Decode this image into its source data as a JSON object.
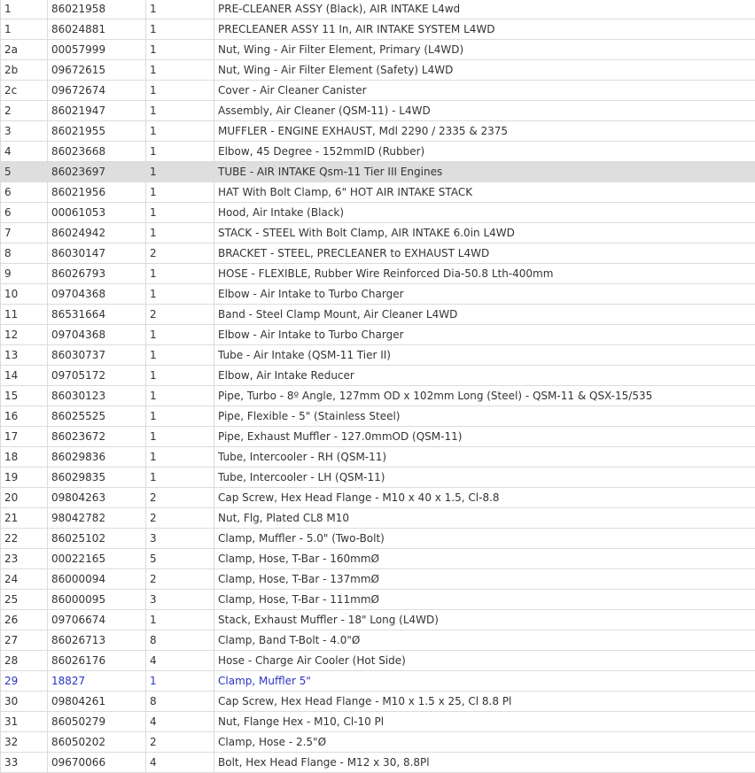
{
  "colors": {
    "text": "#333333",
    "highlight_row_bg": "#dedede",
    "link_text": "#2a35c5",
    "border": "#dcdcdc"
  },
  "parts_table": {
    "rows": [
      {
        "ref": "1",
        "part_no": "86021958",
        "qty": "1",
        "description": "PRE-CLEANER ASSY (Black), AIR INTAKE L4wd",
        "state": "normal"
      },
      {
        "ref": "1",
        "part_no": "86024881",
        "qty": "1",
        "description": "PRECLEANER ASSY 11 In, AIR INTAKE SYSTEM L4WD",
        "state": "normal"
      },
      {
        "ref": "2a",
        "part_no": "00057999",
        "qty": "1",
        "description": "Nut, Wing - Air Filter Element, Primary (L4WD)",
        "state": "normal"
      },
      {
        "ref": "2b",
        "part_no": "09672615",
        "qty": "1",
        "description": "Nut, Wing - Air Filter Element (Safety) L4WD",
        "state": "normal"
      },
      {
        "ref": "2c",
        "part_no": "09672674",
        "qty": "1",
        "description": "Cover - Air Cleaner Canister",
        "state": "normal"
      },
      {
        "ref": "2",
        "part_no": "86021947",
        "qty": "1",
        "description": "Assembly, Air Cleaner (QSM-11) - L4WD",
        "state": "normal"
      },
      {
        "ref": "3",
        "part_no": "86021955",
        "qty": "1",
        "description": "MUFFLER - ENGINE EXHAUST, Mdl 2290 / 2335 & 2375",
        "state": "normal"
      },
      {
        "ref": "4",
        "part_no": "86023668",
        "qty": "1",
        "description": "Elbow, 45 Degree - 152mmID (Rubber)",
        "state": "normal"
      },
      {
        "ref": "5",
        "part_no": "86023697",
        "qty": "1",
        "description": "TUBE - AIR INTAKE Qsm-11 Tier III Engines",
        "state": "highlighted"
      },
      {
        "ref": "6",
        "part_no": "86021956",
        "qty": "1",
        "description": "HAT With Bolt Clamp, 6\" HOT AIR INTAKE STACK",
        "state": "normal"
      },
      {
        "ref": "6",
        "part_no": "00061053",
        "qty": "1",
        "description": "Hood, Air Intake (Black)",
        "state": "normal"
      },
      {
        "ref": "7",
        "part_no": "86024942",
        "qty": "1",
        "description": "STACK - STEEL With Bolt Clamp, AIR INTAKE 6.0in L4WD",
        "state": "normal"
      },
      {
        "ref": "8",
        "part_no": "86030147",
        "qty": "2",
        "description": "BRACKET - STEEL, PRECLEANER to EXHAUST L4WD",
        "state": "normal"
      },
      {
        "ref": "9",
        "part_no": "86026793",
        "qty": "1",
        "description": "HOSE - FLEXIBLE, Rubber Wire Reinforced Dia-50.8 Lth-400mm",
        "state": "normal"
      },
      {
        "ref": "10",
        "part_no": "09704368",
        "qty": "1",
        "description": "Elbow - Air Intake to Turbo Charger",
        "state": "normal"
      },
      {
        "ref": "11",
        "part_no": "86531664",
        "qty": "2",
        "description": "Band - Steel Clamp Mount, Air Cleaner L4WD",
        "state": "normal"
      },
      {
        "ref": "12",
        "part_no": "09704368",
        "qty": "1",
        "description": "Elbow - Air Intake to Turbo Charger",
        "state": "normal"
      },
      {
        "ref": "13",
        "part_no": "86030737",
        "qty": "1",
        "description": "Tube - Air Intake (QSM-11 Tier II)",
        "state": "normal"
      },
      {
        "ref": "14",
        "part_no": "09705172",
        "qty": "1",
        "description": "Elbow, Air Intake Reducer",
        "state": "normal"
      },
      {
        "ref": "15",
        "part_no": "86030123",
        "qty": "1",
        "description": "Pipe, Turbo - 8º Angle, 127mm OD x 102mm Long (Steel) - QSM-11 & QSX-15/535",
        "state": "normal"
      },
      {
        "ref": "16",
        "part_no": "86025525",
        "qty": "1",
        "description": "Pipe, Flexible - 5\" (Stainless Steel)",
        "state": "normal"
      },
      {
        "ref": "17",
        "part_no": "86023672",
        "qty": "1",
        "description": "Pipe, Exhaust Muffler - 127.0mmOD (QSM-11)",
        "state": "normal"
      },
      {
        "ref": "18",
        "part_no": "86029836",
        "qty": "1",
        "description": "Tube, Intercooler - RH (QSM-11)",
        "state": "normal"
      },
      {
        "ref": "19",
        "part_no": "86029835",
        "qty": "1",
        "description": "Tube, Intercooler - LH (QSM-11)",
        "state": "normal"
      },
      {
        "ref": "20",
        "part_no": "09804263",
        "qty": "2",
        "description": "Cap Screw, Hex Head Flange - M10 x 40 x 1.5, Cl-8.8",
        "state": "normal"
      },
      {
        "ref": "21",
        "part_no": "98042782",
        "qty": "2",
        "description": "Nut, Flg, Plated CL8 M10",
        "state": "normal"
      },
      {
        "ref": "22",
        "part_no": "86025102",
        "qty": "3",
        "description": "Clamp, Muffler - 5.0\" (Two-Bolt)",
        "state": "normal"
      },
      {
        "ref": "23",
        "part_no": "00022165",
        "qty": "5",
        "description": "Clamp, Hose, T-Bar - 160mmØ",
        "state": "normal"
      },
      {
        "ref": "24",
        "part_no": "86000094",
        "qty": "2",
        "description": "Clamp, Hose, T-Bar - 137mmØ",
        "state": "normal"
      },
      {
        "ref": "25",
        "part_no": "86000095",
        "qty": "3",
        "description": "Clamp, Hose, T-Bar - 111mmØ",
        "state": "normal"
      },
      {
        "ref": "26",
        "part_no": "09706674",
        "qty": "1",
        "description": "Stack, Exhaust Muffler - 18\" Long (L4WD)",
        "state": "normal"
      },
      {
        "ref": "27",
        "part_no": "86026713",
        "qty": "8",
        "description": "Clamp, Band T-Bolt - 4.0\"Ø",
        "state": "normal"
      },
      {
        "ref": "28",
        "part_no": "86026176",
        "qty": "4",
        "description": "Hose - Charge Air Cooler (Hot Side)",
        "state": "normal"
      },
      {
        "ref": "29",
        "part_no": "18827",
        "qty": "1",
        "description": "Clamp, Muffler 5\"",
        "state": "link"
      },
      {
        "ref": "30",
        "part_no": "09804261",
        "qty": "8",
        "description": "Cap Screw, Hex Head Flange - M10 x 1.5 x 25, Cl 8.8 Pl",
        "state": "normal"
      },
      {
        "ref": "31",
        "part_no": "86050279",
        "qty": "4",
        "description": "Nut, Flange Hex - M10, Cl-10 Pl",
        "state": "normal"
      },
      {
        "ref": "32",
        "part_no": "86050202",
        "qty": "2",
        "description": "Clamp, Hose - 2.5\"Ø",
        "state": "normal"
      },
      {
        "ref": "33",
        "part_no": "09670066",
        "qty": "4",
        "description": "Bolt, Hex Head Flange - M12 x 30, 8.8Pl",
        "state": "normal"
      }
    ]
  }
}
